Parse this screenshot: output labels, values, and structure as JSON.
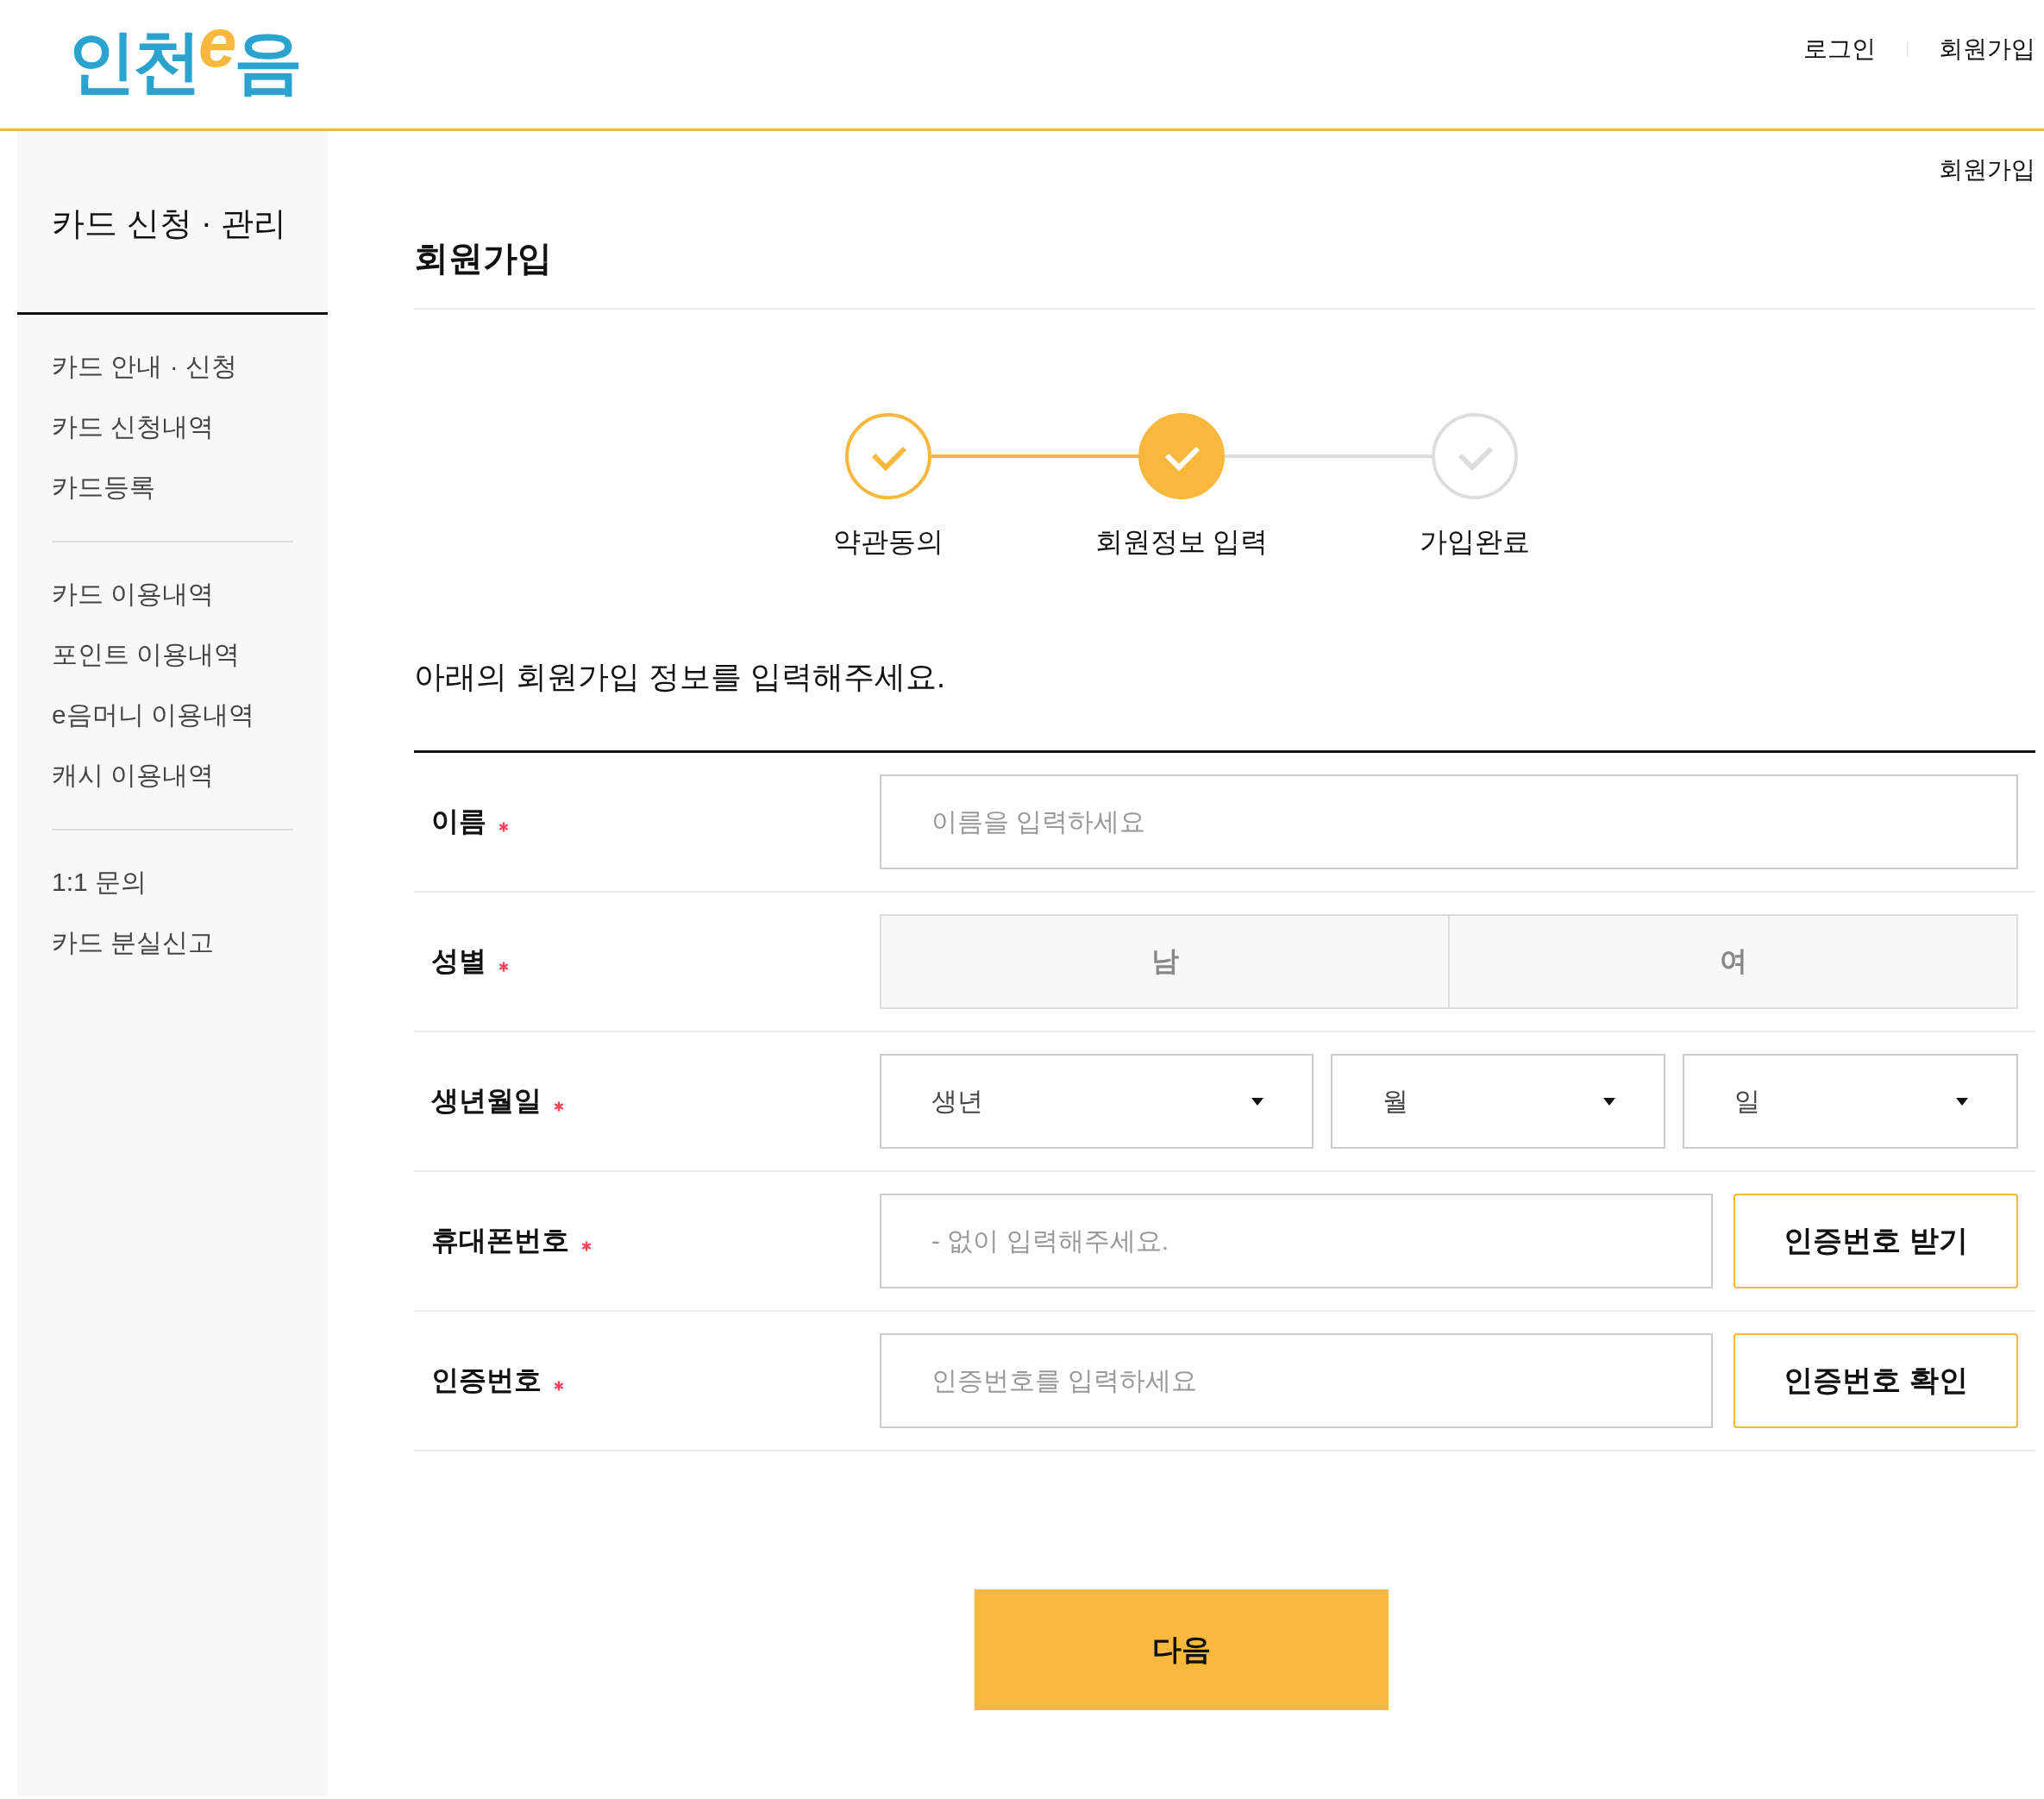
{
  "header": {
    "logo": {
      "first": "인천",
      "accent": "e",
      "last": "음"
    },
    "links": [
      "로그인",
      "회원가입"
    ]
  },
  "sidebar": {
    "title": "카드 신청 · 관리",
    "groups": [
      {
        "items": [
          "카드 안내 · 신청",
          "카드 신청내역",
          "카드등록"
        ]
      },
      {
        "items": [
          "카드 이용내역",
          "포인트 이용내역",
          "e음머니 이용내역",
          "캐시 이용내역"
        ]
      },
      {
        "items": [
          "1:1 문의",
          "카드 분실신고"
        ]
      }
    ]
  },
  "breadcrumb": "회원가입",
  "page_title": "회원가입",
  "steps": [
    {
      "label": "약관동의",
      "completed": true,
      "selected": false
    },
    {
      "label": "회원정보 입력",
      "completed": true,
      "selected": true
    },
    {
      "label": "가입완료",
      "completed": false,
      "selected": false
    }
  ],
  "intro": "아래의 회원가입 정보를 입력해주세요.",
  "form": [
    {
      "kind": "text",
      "label": "이름",
      "required": true,
      "placeholder": "이름을 입력하세요"
    },
    {
      "kind": "choice",
      "label": "성별",
      "required": true,
      "options": [
        {
          "label": "남",
          "selected": false
        },
        {
          "label": "여",
          "selected": false
        }
      ]
    },
    {
      "kind": "selects",
      "label": "생년월일",
      "required": true,
      "selects": [
        {
          "value": "생년"
        },
        {
          "value": "월"
        },
        {
          "value": "일"
        }
      ]
    },
    {
      "kind": "action",
      "label": "휴대폰번호",
      "required": true,
      "placeholder": "- 없이 입력해주세요.",
      "button": "인증번호 받기"
    },
    {
      "kind": "action",
      "label": "인증번호",
      "required": true,
      "placeholder": "인증번호를 입력하세요",
      "button": "인증번호 확인"
    }
  ],
  "next_button": "다음"
}
